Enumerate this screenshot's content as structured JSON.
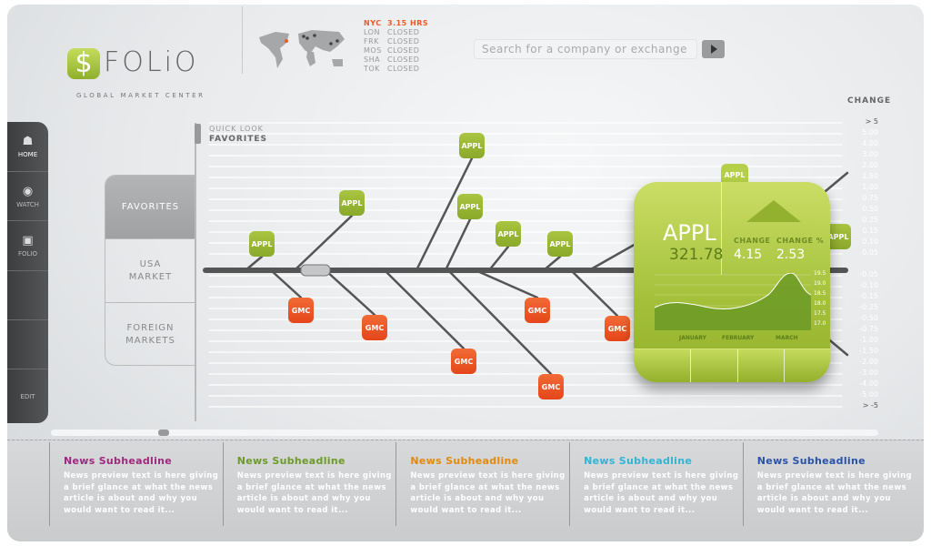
{
  "brand": {
    "logo_symbol": "$",
    "name": "FOLiO",
    "tagline": "GLOBAL MARKET CENTER",
    "accent": "#9dbd35"
  },
  "markets": [
    {
      "city": "NYC",
      "status": "3.15 HRS",
      "open": true
    },
    {
      "city": "LON",
      "status": "CLOSED"
    },
    {
      "city": "FRK",
      "status": "CLOSED"
    },
    {
      "city": "MOS",
      "status": "CLOSED"
    },
    {
      "city": "SHA",
      "status": "CLOSED"
    },
    {
      "city": "TOK",
      "status": "CLOSED"
    }
  ],
  "search": {
    "placeholder": "Search for a company or exchange"
  },
  "nav": [
    {
      "label": "HOME",
      "icon": "home-icon"
    },
    {
      "label": "WATCH",
      "icon": "eye-icon"
    },
    {
      "label": "FOLIO",
      "icon": "briefcase-icon"
    },
    {
      "label": ""
    },
    {
      "label": ""
    },
    {
      "label": "EDIT"
    }
  ],
  "tabs": [
    {
      "label": "FAVORITES",
      "active": true
    },
    {
      "label": "USA MARKET"
    },
    {
      "label": "FOREIGN MARKETS"
    }
  ],
  "quick_look": {
    "label": "QUICK LOOK",
    "section": "FAVORITES"
  },
  "change_scale": {
    "title": "CHANGE",
    "ticks": [
      "> 5",
      "5.00",
      "4.00",
      "3.00",
      "2.00",
      "1.50",
      "1.00",
      "0.75",
      "0.50",
      "0.25",
      "0.15",
      "0.10",
      "0.05",
      "-0.05",
      "-0.10",
      "-0.15",
      "-0.25",
      "-0.50",
      "-0.75",
      "-1.00",
      "-1.50",
      "-2.00",
      "-3.00",
      "-4.00",
      "-5.00",
      "> -5"
    ]
  },
  "fishbone": {
    "up_label": "APPL",
    "down_label": "GMC",
    "up_color": "#9dbd35",
    "down_color": "#ea5323"
  },
  "card": {
    "symbol": "APPL",
    "price": "321.78",
    "change_label": "CHANGE",
    "change": "4.15",
    "change_pct_label": "CHANGE %",
    "change_pct": "2.53",
    "chart": {
      "y_ticks": [
        "19.5",
        "19.0",
        "18.5",
        "18.0",
        "17.5",
        "17.0"
      ],
      "months": [
        "JANUARY",
        "FEBRUARY",
        "MARCH"
      ]
    }
  },
  "news": [
    {
      "headline": "News Subheadline",
      "text": "News preview text is here giving a brief glance at what the news article is about and why you would want to read it...",
      "color": "#a0287f"
    },
    {
      "headline": "News Subheadline",
      "text": "News preview text is here giving a brief glance at what the news article is about and why you would want to read it...",
      "color": "#6e9a2a"
    },
    {
      "headline": "News Subheadline",
      "text": "News preview text is here giving a brief glance at what the news article is about and why you would want to read it...",
      "color": "#e08a10"
    },
    {
      "headline": "News Subheadline",
      "text": "News preview text is here giving a brief glance at what the news article is about and why you would want to read it...",
      "color": "#2fb5d8"
    },
    {
      "headline": "News Subheadline",
      "text": "News preview text is here giving a brief glance at what the news article is about and why you would want to read it...",
      "color": "#2a52a8"
    }
  ]
}
